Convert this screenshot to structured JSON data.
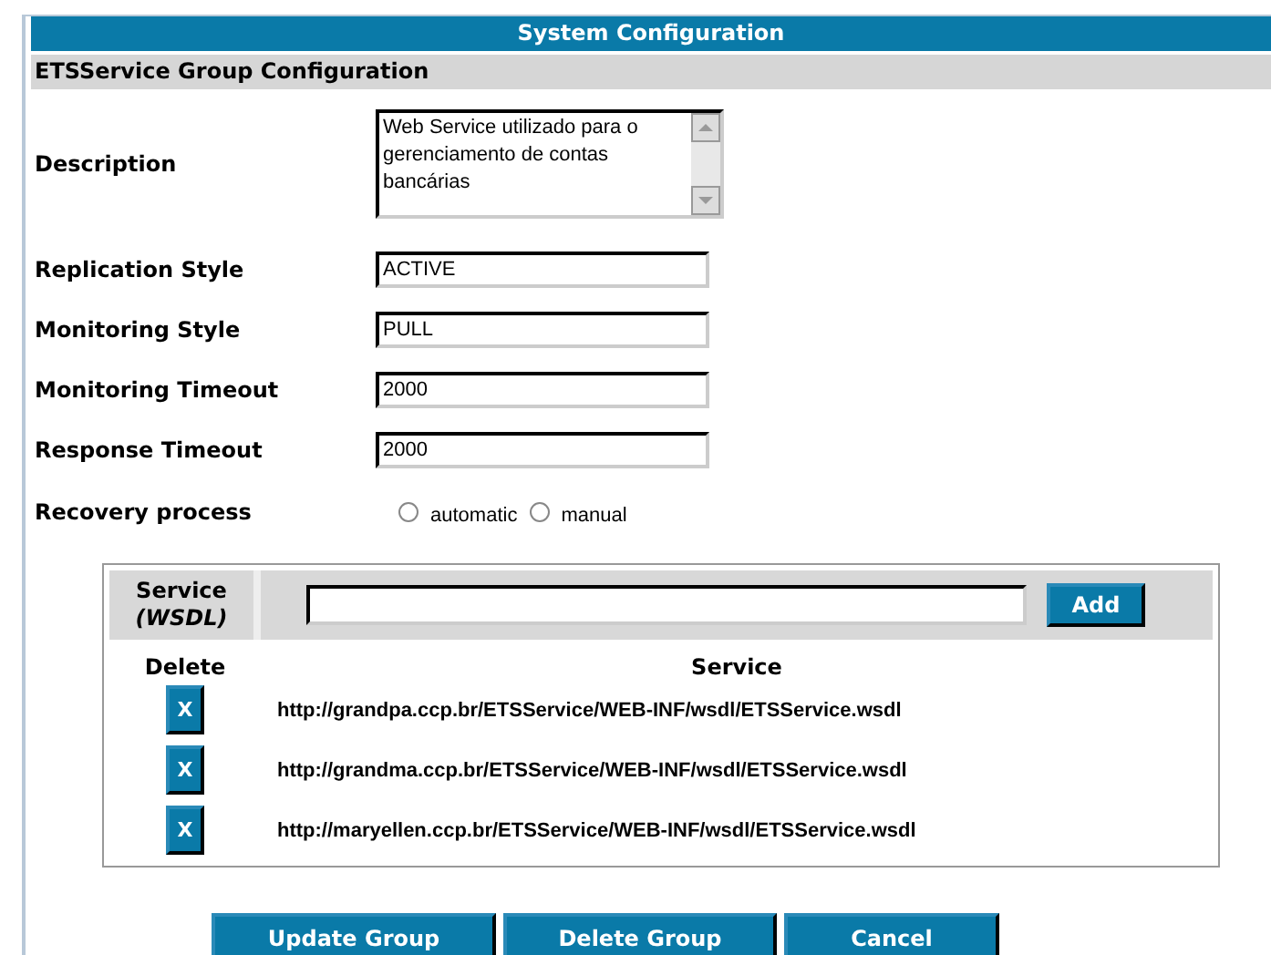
{
  "header": {
    "title": "System Configuration"
  },
  "section": {
    "title": "ETSService Group Configuration"
  },
  "description": {
    "label": "Description",
    "value": "Web Service utilizado para o gerenciamento de contas bancárias"
  },
  "fields": [
    {
      "label": "Replication Style",
      "value": "ACTIVE"
    },
    {
      "label": "Monitoring Style",
      "value": "PULL"
    },
    {
      "label": "Monitoring Timeout",
      "value": "2000"
    },
    {
      "label": "Response Timeout",
      "value": "2000"
    }
  ],
  "recovery": {
    "label": "Recovery process",
    "options": [
      {
        "label": "automatic",
        "selected": false
      },
      {
        "label": "manual",
        "selected": false
      }
    ]
  },
  "services": {
    "input_label": "Service",
    "input_label_note": "(WSDL)",
    "add_button": "Add",
    "columns": [
      "Delete",
      "Service"
    ],
    "rows": [
      {
        "delete": "X",
        "url": "http://grandpa.ccp.br/ETSService/WEB-INF/wsdl/ETSService.wsdl"
      },
      {
        "delete": "X",
        "url": "http://grandma.ccp.br/ETSService/WEB-INF/wsdl/ETSService.wsdl"
      },
      {
        "delete": "X",
        "url": "http://maryellen.ccp.br/ETSService/WEB-INF/wsdl/ETSService.wsdl"
      }
    ]
  },
  "buttons": [
    "Update Group",
    "Delete Group",
    "Cancel"
  ]
}
